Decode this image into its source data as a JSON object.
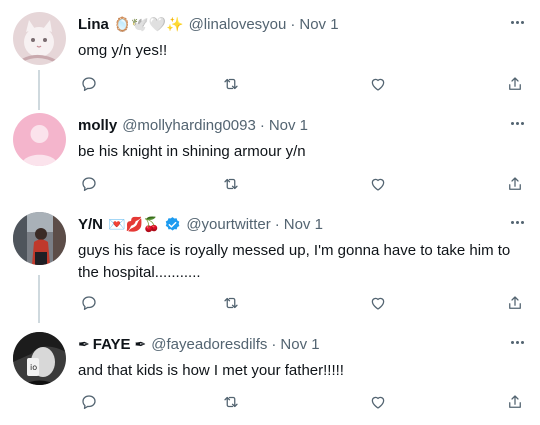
{
  "colors": {
    "text": "#0f1419",
    "secondary": "#536471",
    "thread_line": "#cfd9de",
    "verified": "#1d9bf0"
  },
  "tweets": [
    {
      "name": "Lina",
      "emojis": "🪞🕊️🤍✨",
      "handle": "@linalovesyou",
      "dot": "·",
      "time": "Nov 1",
      "text": "omg y/n yes!!",
      "avatar": "cat-avatar"
    },
    {
      "name": "molly",
      "emojis": "",
      "handle": "@mollyharding0093",
      "dot": "·",
      "time": "Nov 1",
      "text": "be his knight in shining armour y/n",
      "avatar": "default-pink-avatar"
    },
    {
      "name": "Y/N",
      "emojis": "💌💋🍒",
      "handle": "@yourtwitter",
      "dot": "·",
      "time": "Nov 1",
      "text": "guys his face is royally messed up, I'm gonna have to take him to the hospital...........",
      "avatar": "street-photo-avatar",
      "verified": true
    },
    {
      "name": "FAYE",
      "name_prefix": "✒",
      "name_suffix": "✒",
      "handle": "@fayeadoresdilfs",
      "dot": "·",
      "time": "Nov 1",
      "text": "and that kids is how I met your father!!!!!",
      "avatar": "bw-selfie-avatar"
    }
  ]
}
